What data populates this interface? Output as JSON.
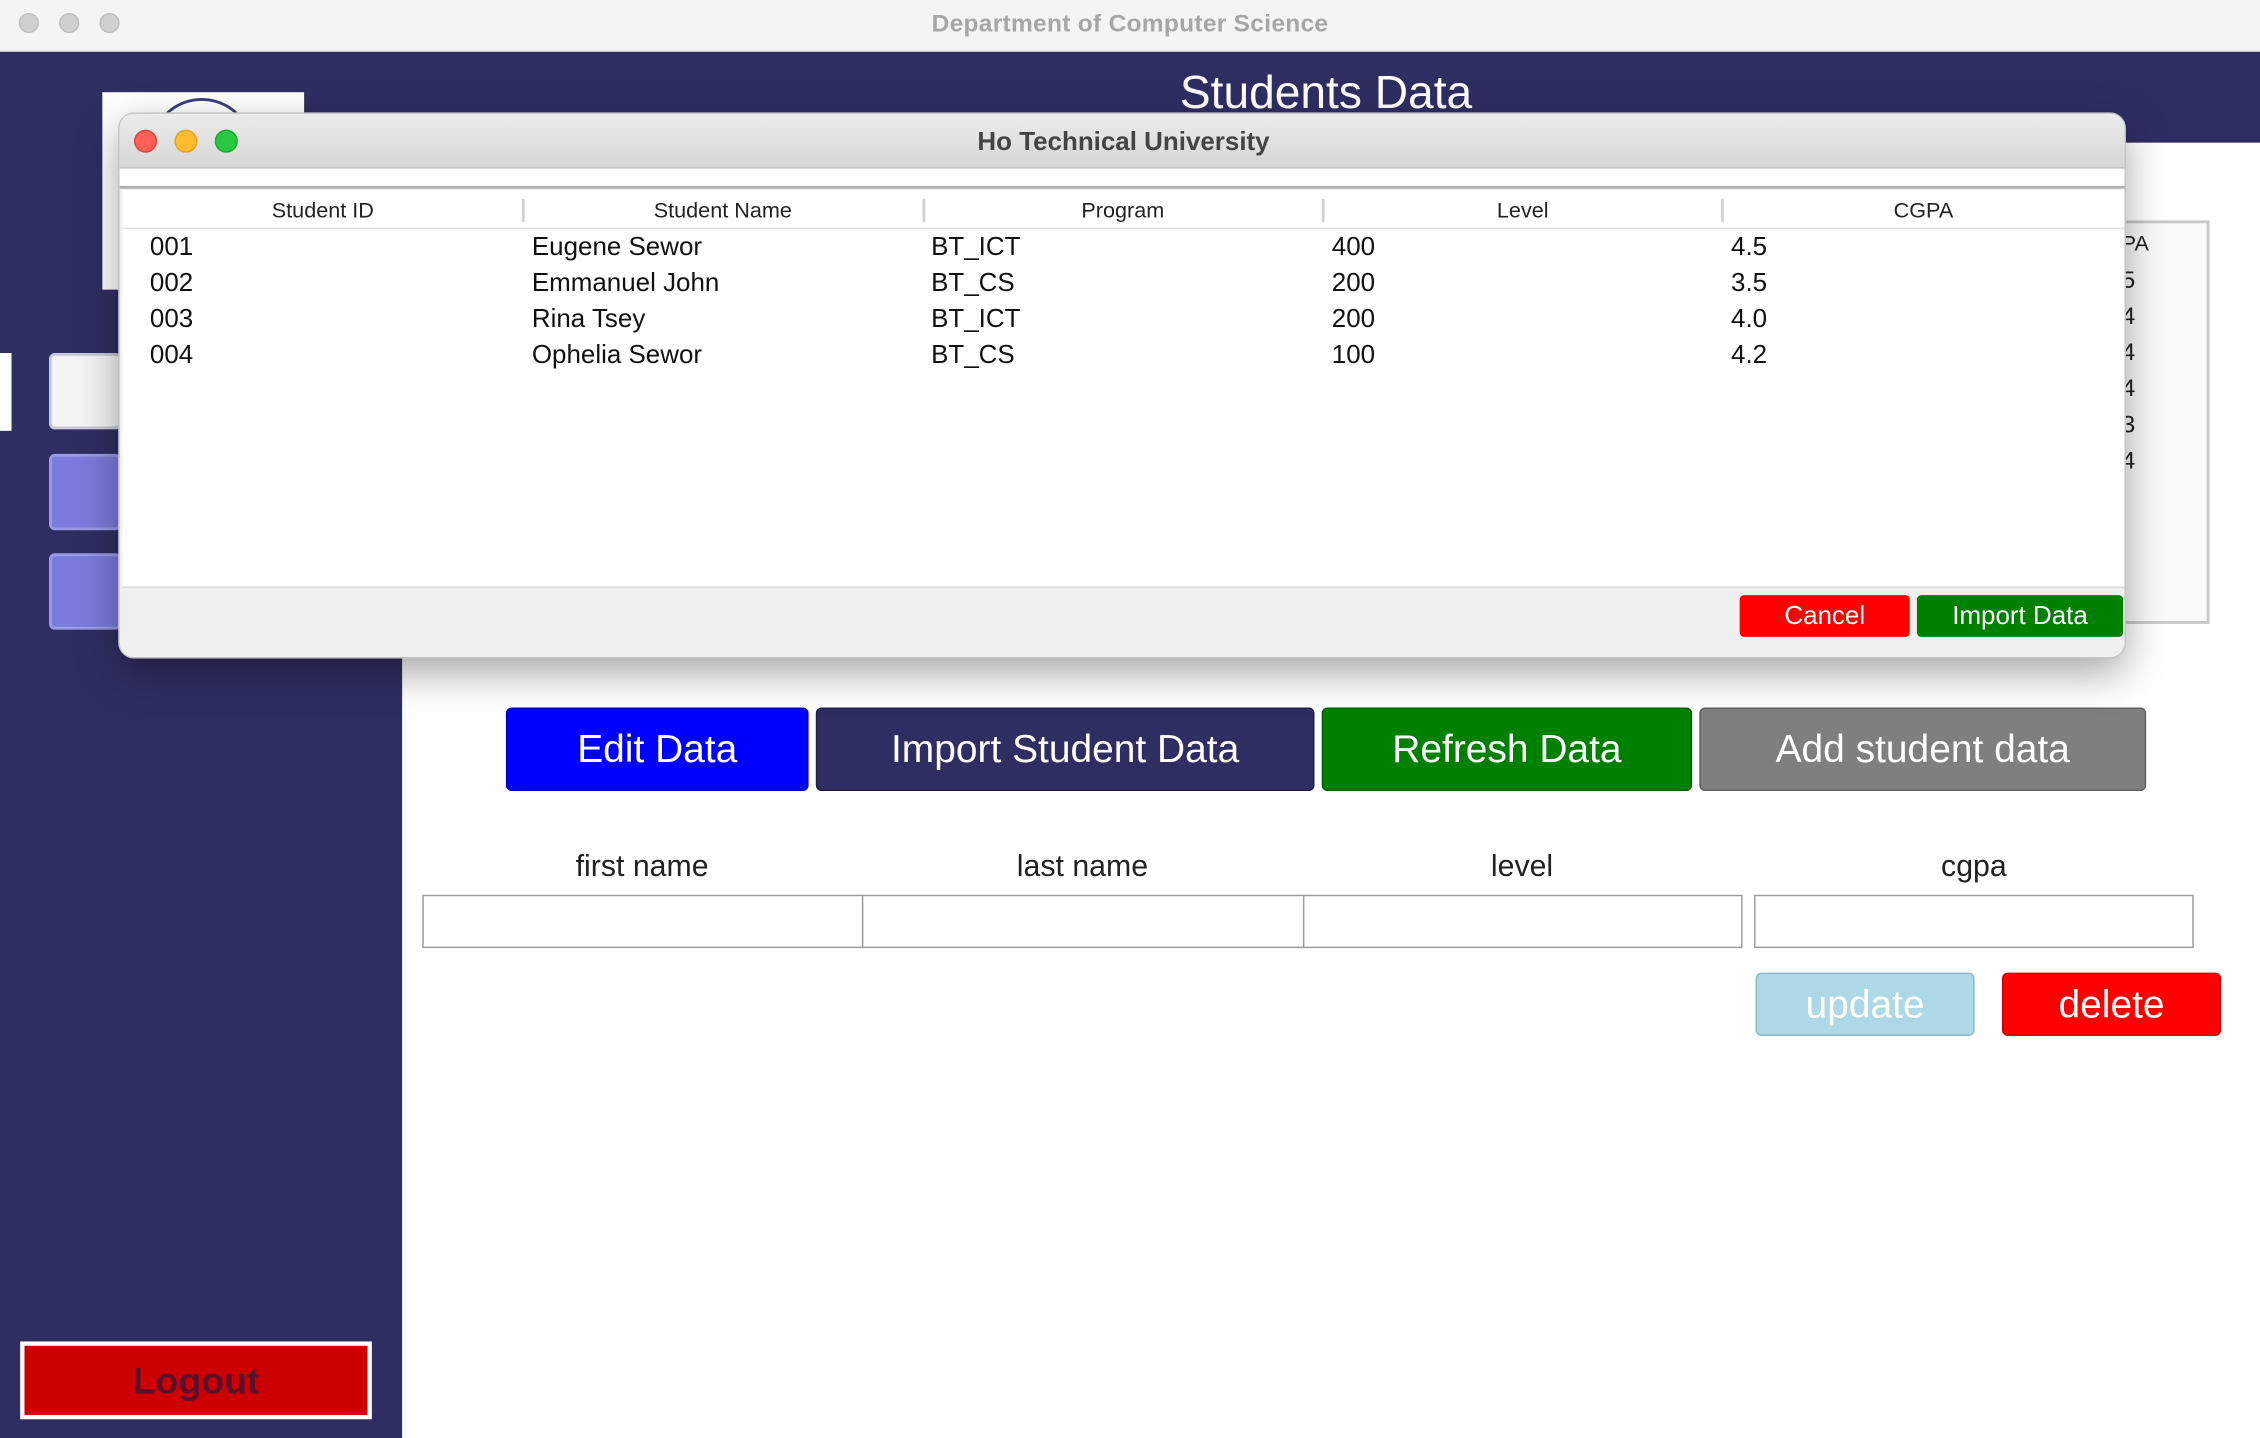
{
  "window": {
    "title": "Department  of Computer Science"
  },
  "header": {
    "title": "Students Data"
  },
  "sidebar": {
    "logout_label": "Logout"
  },
  "background_table": {
    "header_fragment": "PA",
    "cell_fragments": [
      "5",
      "4",
      "4",
      "4",
      "3",
      "4"
    ]
  },
  "actions": {
    "edit_label": "Edit Data",
    "import_student_label": "Import Student Data",
    "refresh_label": "Refresh Data",
    "add_label": "Add student data"
  },
  "form": {
    "first_name_label": "first name",
    "last_name_label": "last name",
    "level_label": "level",
    "cgpa_label": "cgpa",
    "first_name_value": "",
    "last_name_value": "",
    "level_value": "",
    "cgpa_value": "",
    "update_label": "update",
    "delete_label": "delete"
  },
  "dialog": {
    "title": "Ho Technical University",
    "columns": [
      "Student ID",
      "Student Name",
      "Program",
      "Level",
      "CGPA"
    ],
    "rows": [
      [
        "001",
        "Eugene Sewor",
        "BT_ICT",
        "400",
        "4.5"
      ],
      [
        "002",
        "Emmanuel John",
        "BT_CS",
        "200",
        "3.5"
      ],
      [
        "003",
        "Rina Tsey",
        "BT_ICT",
        "200",
        "4.0"
      ],
      [
        "004",
        "Ophelia Sewor",
        "BT_CS",
        "100",
        "4.2"
      ]
    ],
    "cancel_label": "Cancel",
    "import_label": "Import Data"
  },
  "colors": {
    "sidebar": "#2f2e63",
    "edit": "#0000ff",
    "refresh": "#008000",
    "add": "#7f7f7f",
    "update": "#add8e6",
    "delete": "#ff0000"
  }
}
